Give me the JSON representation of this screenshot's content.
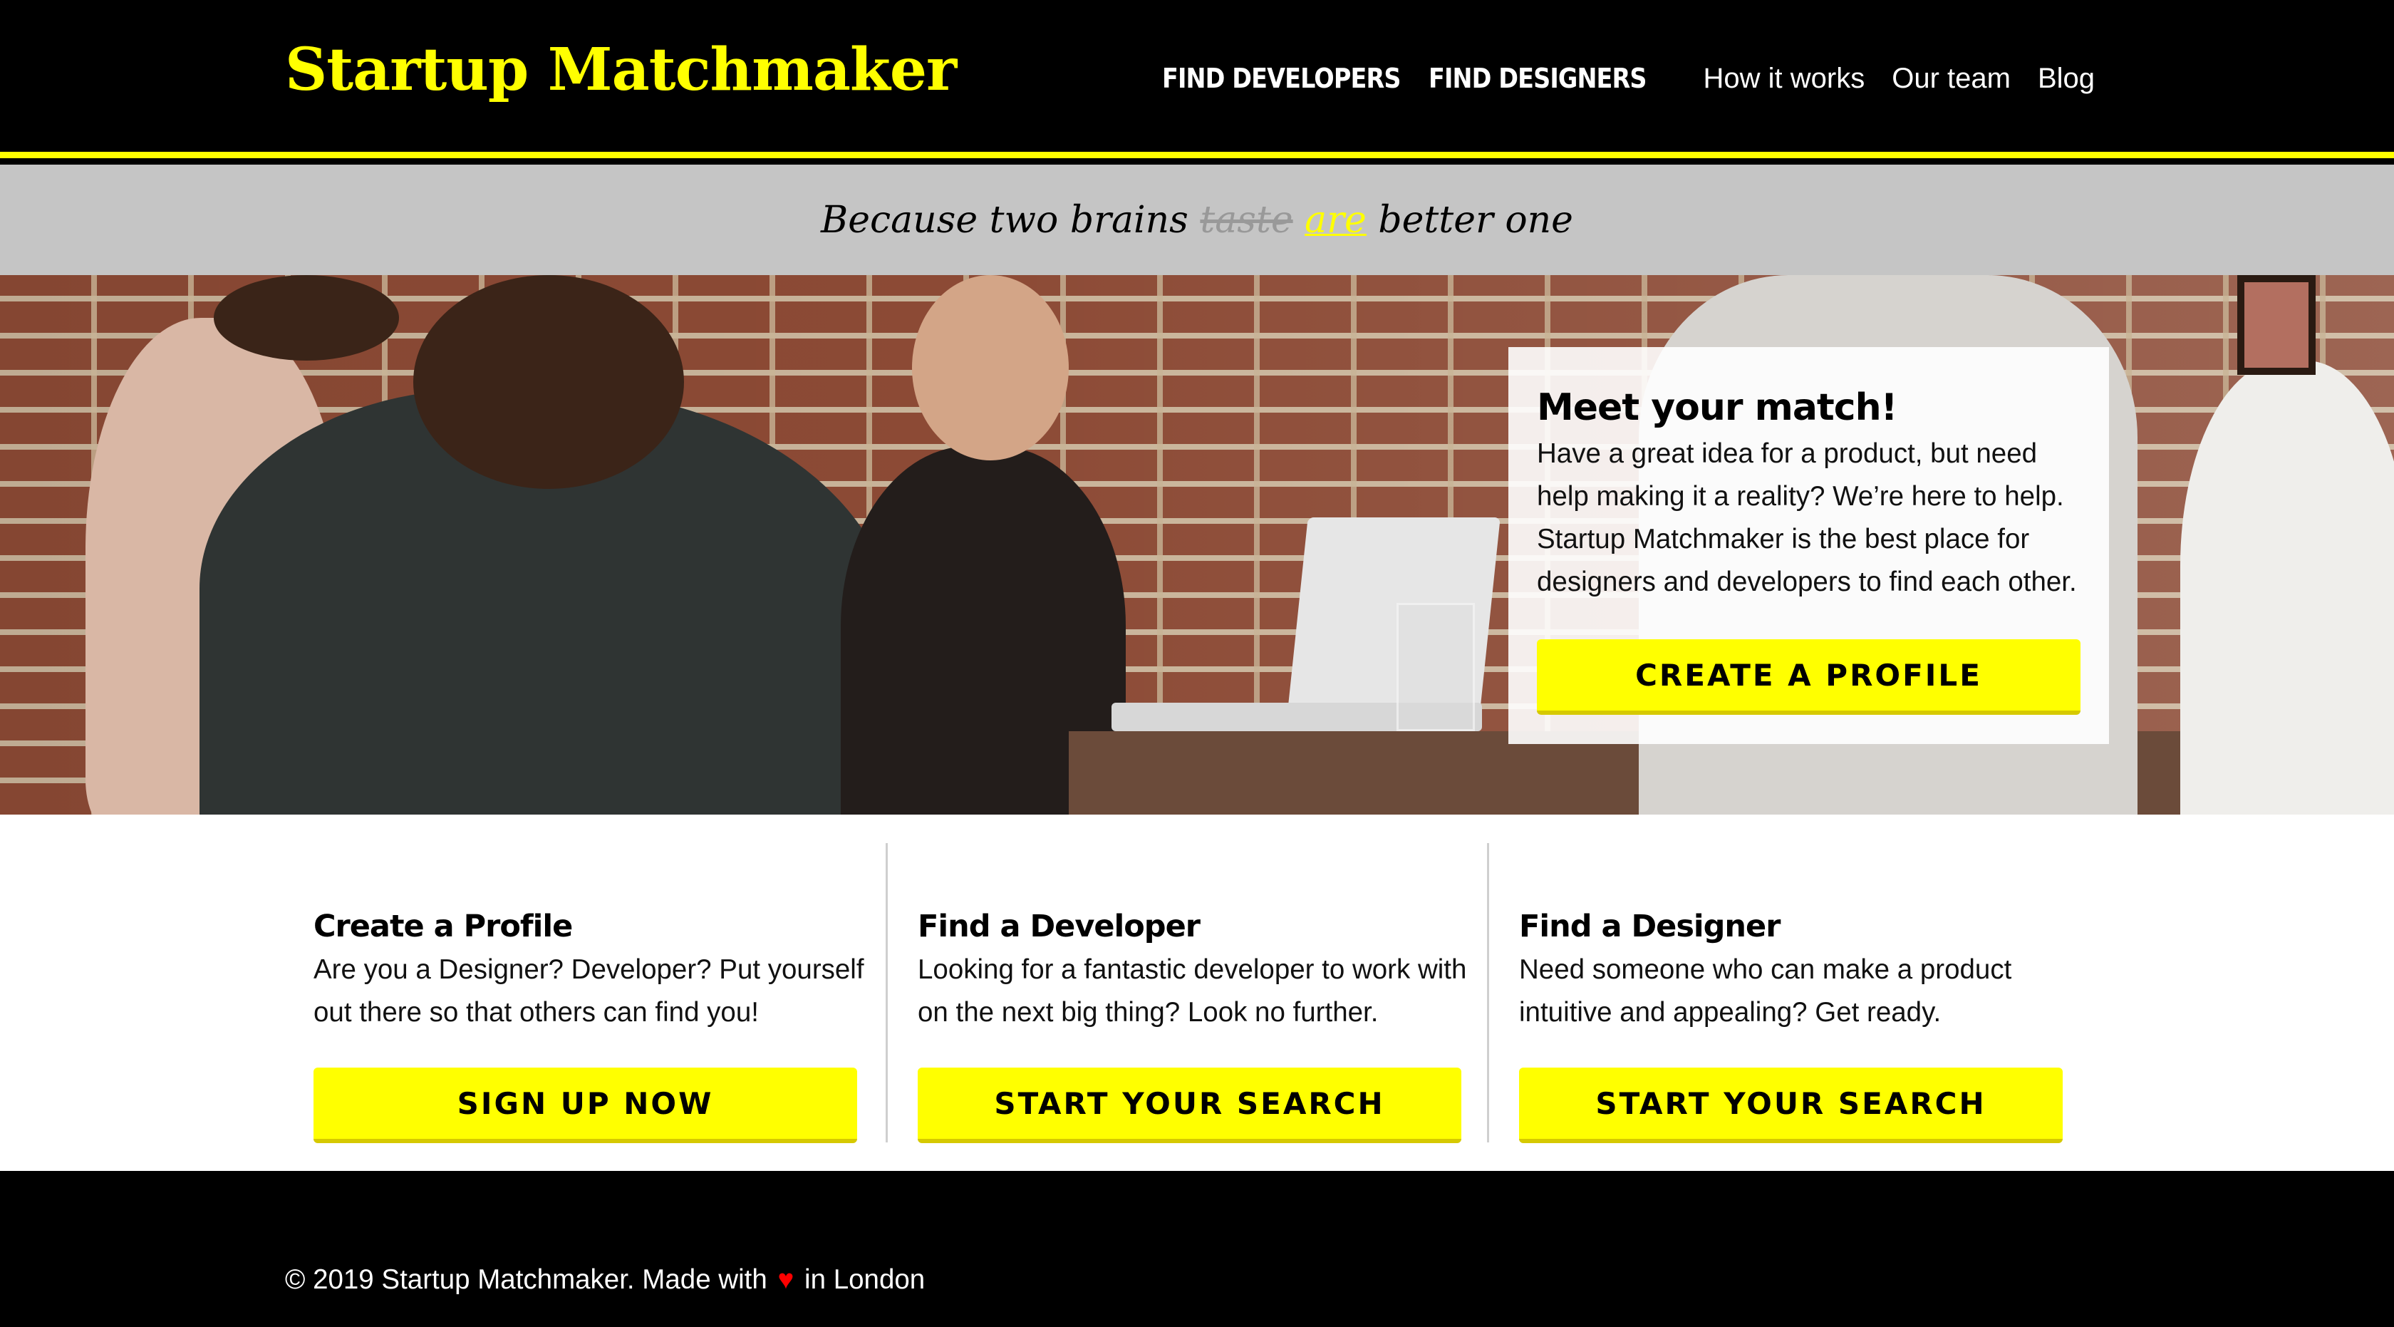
{
  "header": {
    "logo": "Startup Matchmaker",
    "nav": {
      "find_developers": "FIND DEVELOPERS",
      "find_designers": "FIND DESIGNERS",
      "how_it_works": "How it works",
      "our_team": "Our team",
      "blog": "Blog"
    }
  },
  "tagline": {
    "start": "Because two brains",
    "struck": "taste",
    "highlight": "are",
    "end": "better one"
  },
  "hero": {
    "card_title": "Meet your match!",
    "card_text": "Have a great idea for a product, but need help making it a reality? We’re here to help. Startup Matchmaker is the best place for designers and developers to find each other.",
    "cta": "CREATE A PROFILE"
  },
  "features": [
    {
      "title": "Create a Profile",
      "text": "Are you a Designer? Developer? Put yourself out there so that others can find you!",
      "button": "SIGN UP NOW"
    },
    {
      "title": "Find a Developer",
      "text": "Looking for a fantastic developer to work with on the next big thing? Look no further.",
      "button": "START YOUR SEARCH"
    },
    {
      "title": "Find a Designer",
      "text": "Need someone who can make a product intuitive and appealing? Get ready.",
      "button": "START YOUR SEARCH"
    }
  ],
  "footer": {
    "prefix": "© 2019 Startup Matchmaker. Made with",
    "heart_icon": "heart-icon",
    "suffix": "in London"
  },
  "colors": {
    "accent": "#ffff00",
    "background": "#000000",
    "tagline_band": "#c5c5c5",
    "heart": "#ff0000"
  }
}
